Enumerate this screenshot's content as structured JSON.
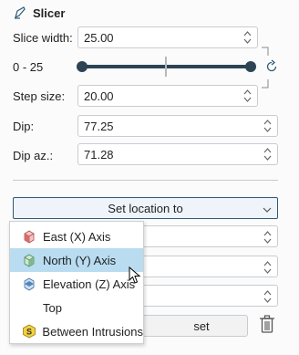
{
  "panel": {
    "title": "Slicer",
    "title_icon": "pen-icon"
  },
  "slice_width": {
    "label": "Slice width:",
    "value": "25.00"
  },
  "range": {
    "label": "0 - 25",
    "reset_icon": "reset-icon",
    "link_icon": "link-bracket-icon"
  },
  "step_size": {
    "label": "Step size:",
    "value": "20.00"
  },
  "dip": {
    "label": "Dip:",
    "value": "77.25"
  },
  "dip_az": {
    "label": "Dip az.:",
    "value": "71.28"
  },
  "set_location": {
    "label": "Set location to"
  },
  "background_button": {
    "label": "set"
  },
  "menu": {
    "items": [
      {
        "label": "East (X) Axis",
        "icon": "east-axis-icon"
      },
      {
        "label": "North (Y) Axis",
        "icon": "north-axis-icon",
        "selected": true
      },
      {
        "label": "Elevation (Z) Axis",
        "icon": "elevation-axis-icon"
      },
      {
        "label": "Top",
        "icon": ""
      },
      {
        "label": "Between Intrusions",
        "icon": "between-intrusions-icon"
      }
    ]
  },
  "colors": {
    "accent": "#2e5a76",
    "selection": "#b9dcf1",
    "slider_track": "#2c4454"
  }
}
